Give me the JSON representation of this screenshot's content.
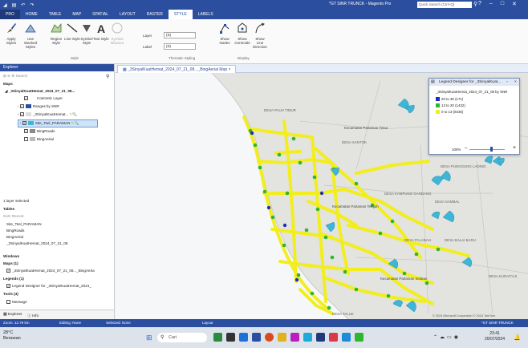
{
  "titlebar": {
    "title": "*GT SINR TRUNCK - Magento Pro",
    "search_placeholder": "Quick Search (Ctrl+Q)",
    "controls": [
      "?",
      "–",
      "□",
      "✕"
    ]
  },
  "tabs": [
    "PRO",
    "HOME",
    "TABLE",
    "MAP",
    "SPATIAL",
    "LAYOUT",
    "RASTER",
    "STYLE",
    "LABELS"
  ],
  "active_tab": "STYLE",
  "ribbon": {
    "buttons": [
      "Apply Styles",
      "Use Stacked Styles",
      "Region Style",
      "Line Style",
      "Symbol Style",
      "Text Style",
      "Symbol Blowout"
    ],
    "group_style": "Style",
    "layer_label": "Layer",
    "layer_value": "(S)",
    "label_label": "Label",
    "label_value": "(S)",
    "group_thematic": "Thematic Styling",
    "display_buttons": [
      "Show Nodes",
      "Show Centroids",
      "Show Line Direction"
    ],
    "group_display": "Display"
  },
  "explorer": {
    "title": "Explorer",
    "search_placeholder": "Search",
    "maps_header": "Maps",
    "map_name": "_3SinyalKuatHemat_2024_07_21_08...",
    "layers": [
      {
        "name": "Cosmetic Layer",
        "checked": true
      },
      {
        "name": "Ranges by SNR",
        "checked": true
      },
      {
        "name": "_3SinyalKuatHemat...",
        "checked": true
      },
      {
        "name": "Site_Tsel_PARAMAN",
        "checked": true
      },
      {
        "name": "BingRoads",
        "checked": true
      },
      {
        "name": "BingAerial",
        "checked": false
      }
    ],
    "layer_selected": "1 layer selected",
    "tables_header": "Tables",
    "tables_sort": "Sort: Recent",
    "tables": [
      "Site_Tsel_PARAMAN",
      "BingRoads",
      "BingAerial",
      "_3SinyalKuatHemat_2024_07_21_08"
    ],
    "windows_header": "Windows",
    "maps_count": "Maps (1)",
    "map_window": "_3SinyalKuatHemat_2024_07_21_08..._BingAeria",
    "legends_count": "Legends (1)",
    "legend_window": "Legend Designer for _3SinyalKuatHemat_2024_",
    "tools_count": "Tools (4)",
    "tool_item": "Message",
    "bottom_tabs": [
      "Explorer",
      "Info"
    ]
  },
  "view_tab": {
    "label": "_3SinyalKuatHemat_2024_07_21_08..._BingAerial Map",
    "close": "×"
  },
  "map_labels": [
    "Kecamatan Pariaman Timur",
    "Kecamatan Pariaman Tengah",
    "Kecamatan Pariaman Selatan",
    "DESA PAUH TIMUR",
    "DESA SANTOK",
    "DESA PUNGGUNG LADING",
    "DESA KAMPUNG GANDANG",
    "DESA SAMBAL",
    "DESA BALAI BARU",
    "DESA PALABAH",
    "DESA TALUK",
    "DESA KURAITAJI",
    "© 2024 Microsoft Corporation © 2024 TomTom"
  ],
  "legend": {
    "title": "Legend Designer for _3SinyalKuat...",
    "layer_title": "_3SinyalKuatHemat_2024_07_21_08 by SNR",
    "items": [
      {
        "label": "20 to 30   (171)",
        "color": "#1c2fb8"
      },
      {
        "label": "13 to 20  (1432)",
        "color": "#2fb52f"
      },
      {
        "label": "0 to 13   (8436)",
        "color": "#f2ee1e"
      }
    ],
    "zoom": "100%"
  },
  "statusbar": {
    "zoom": "Zoom: 12.79 km",
    "editing": "Editing: None",
    "selected": "Selected: None",
    "layout": "Layout",
    "right": "*GT SINR TRUNCK"
  },
  "taskbar": {
    "weather_temp": "28°C",
    "weather_desc": "Berawan",
    "search": "Cari",
    "time": "23:41",
    "date": "20/07/2024"
  },
  "colors": {
    "accent": "#2b4e9e",
    "route_yellow": "#f2ee1e",
    "route_green": "#2fb52f",
    "route_blue": "#1c2fb8",
    "sea": "#f4f6f8",
    "land": "#e0e0dc",
    "site_cyan": "#3db6d8"
  }
}
